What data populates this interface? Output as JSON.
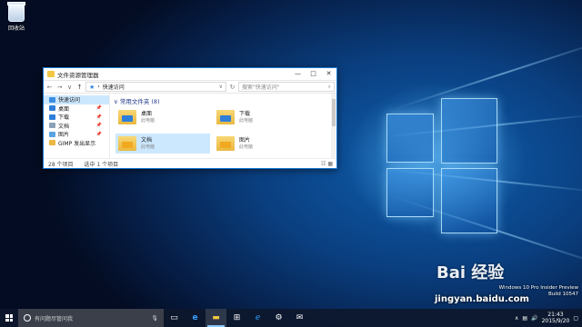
{
  "desktop": {
    "icons": [
      {
        "label": "回收站",
        "icon": "recycle-bin-icon"
      }
    ]
  },
  "explorer": {
    "title": "文件资源管理器",
    "window_buttons": {
      "minimize": "—",
      "maximize": "□",
      "close": "✕"
    },
    "nav_buttons": {
      "back": "←",
      "forward": "→",
      "recent": "∨",
      "up": "↑",
      "refresh": "↻"
    },
    "address": {
      "separator": "›",
      "location": "快速访问"
    },
    "search": {
      "placeholder": "搜索\"快速访问\"",
      "icon": "search-icon"
    },
    "sidebar": [
      {
        "label": "快速访问",
        "color": "#3b8ee0",
        "pinned": false
      },
      {
        "label": "桌面",
        "color": "#2f7fd9",
        "pinned": true
      },
      {
        "label": "下载",
        "color": "#2f7fd9",
        "pinned": true
      },
      {
        "label": "文档",
        "color": "#8aa0b8",
        "pinned": true
      },
      {
        "label": "图片",
        "color": "#5aa2e0",
        "pinned": true
      },
      {
        "label": "GIMP 发出显示",
        "color": "#e9b840",
        "pinned": false
      }
    ],
    "section_title": "常用文件夹 (8)",
    "folders": [
      {
        "name": "桌面",
        "location": "此电脑",
        "style": "blue"
      },
      {
        "name": "下载",
        "location": "此电脑",
        "style": "blue"
      },
      {
        "name": "文档",
        "location": "此电脑",
        "style": "yellow"
      },
      {
        "name": "图片",
        "location": "此电脑",
        "style": "yellow"
      }
    ],
    "status": {
      "count": "28 个项目",
      "selected": "选中 1 个项目"
    }
  },
  "taskbar": {
    "search_placeholder": "有问题尽管问我",
    "clock": {
      "time": "21:43",
      "date": "2015/9/20"
    }
  },
  "watermark": {
    "lines": [
      "Windows 10 Pro Insider Preview",
      "Build 10547"
    ],
    "brand": "Bai 经验",
    "url": "jingyan.baidu.com"
  }
}
